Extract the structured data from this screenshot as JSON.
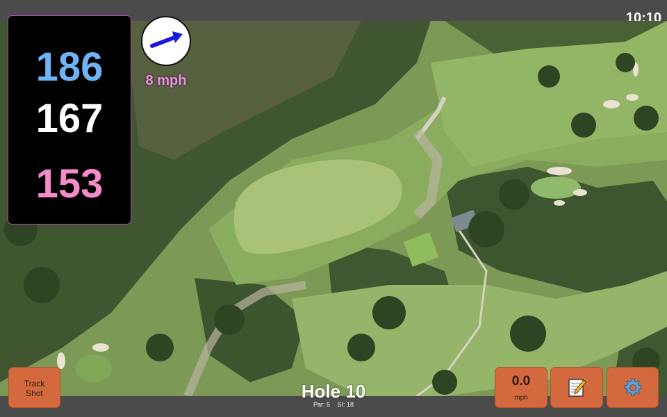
{
  "clock": {
    "time": "10:10"
  },
  "distances": {
    "back": "186",
    "middle": "167",
    "front": "153"
  },
  "wind": {
    "speed_label": "8 mph",
    "direction_icon": "wind-arrow-icon"
  },
  "buttons": {
    "track_shot": "Track\nShot",
    "wind_value": "0.0",
    "wind_unit": "mph",
    "notes_icon": "notepad-icon",
    "settings_icon": "gear-icon"
  },
  "hole": {
    "title": "Hole 10",
    "par": "Par: 5",
    "stroke_index": "SI: 18"
  },
  "colors": {
    "back_distance": "#6fb3f7",
    "middle_distance": "#ffffff",
    "front_distance": "#f58bc8",
    "button": "#d3693d",
    "panel_border": "#b04fb7"
  }
}
